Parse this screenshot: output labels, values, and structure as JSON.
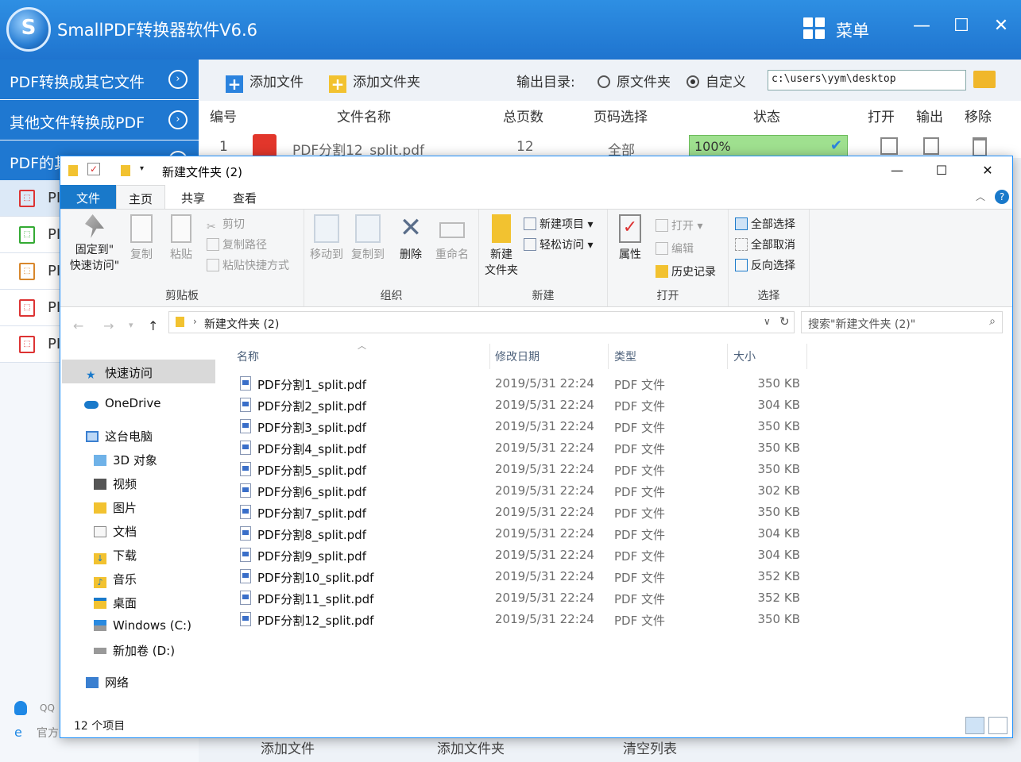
{
  "app": {
    "title": "SmallPDF转换器软件V6.6",
    "logo_letter": "S",
    "menu_label": "菜单",
    "win_min": "—",
    "win_max": "☐",
    "win_close": "✕",
    "nav": [
      {
        "label": "PDF转换成其它文件",
        "arrow": "›"
      },
      {
        "label": "其他文件转换成PDF",
        "arrow": "›"
      },
      {
        "label": "PDF的其他操作",
        "arrow": "›"
      }
    ],
    "sub_items": [
      "PI",
      "PI",
      "PI",
      "PI",
      "PI"
    ],
    "sub_first": "PI",
    "toolbar": {
      "add_file": "添加文件",
      "add_folder": "添加文件夹",
      "output_label": "输出目录:",
      "opt_source": "原文件夹",
      "opt_custom": "自定义",
      "output_path": "c:\\users\\yym\\desktop"
    },
    "table_headers": {
      "num": "编号",
      "name": "文件名称",
      "pages": "总页数",
      "page_select": "页码选择",
      "status": "状态",
      "open": "打开",
      "output": "输出",
      "remove": "移除"
    },
    "row": {
      "num": "1",
      "name": "PDF分割12_split.pdf",
      "pages": "12",
      "page_select": "全部",
      "status": "100%",
      "progress": 1.0
    },
    "bottom": {
      "add_file": "添加文件",
      "add_folder": "添加文件夹",
      "clear": "清空列表"
    },
    "foot": {
      "qq": "QQ",
      "site": "官方"
    }
  },
  "explorer": {
    "title": "新建文件夹 (2)",
    "tabs": {
      "file": "文件",
      "home": "主页",
      "share": "共享",
      "view": "查看"
    },
    "ribbon": {
      "pin_line1": "固定到\"",
      "pin_line2": "快速访问\"",
      "copy": "复制",
      "paste": "粘贴",
      "cut": "剪切",
      "copy_path": "复制路径",
      "paste_shortcut": "粘贴快捷方式",
      "group_clipboard": "剪贴板",
      "move_to": "移动到",
      "copy_to": "复制到",
      "delete": "删除",
      "rename": "重命名",
      "group_organize": "组织",
      "new_folder_line1": "新建",
      "new_folder_line2": "文件夹",
      "new_item": "新建项目",
      "easy_access": "轻松访问",
      "group_new": "新建",
      "properties": "属性",
      "open": "打开",
      "edit": "编辑",
      "history": "历史记录",
      "group_open": "打开",
      "select_all": "全部选择",
      "select_none": "全部取消",
      "invert": "反向选择",
      "group_select": "选择"
    },
    "address": "新建文件夹 (2)",
    "search_placeholder": "搜索\"新建文件夹 (2)\"",
    "nav_pane": {
      "quick_access": "快速访问",
      "onedrive": "OneDrive",
      "this_pc": "这台电脑",
      "objects3d": "3D 对象",
      "videos": "视频",
      "pictures": "图片",
      "documents": "文档",
      "downloads": "下载",
      "music": "音乐",
      "desktop": "桌面",
      "drive_c": "Windows (C:)",
      "drive_d": "新加卷 (D:)",
      "network": "网络"
    },
    "columns": {
      "name": "名称",
      "date": "修改日期",
      "type": "类型",
      "size": "大小"
    },
    "files": [
      {
        "name": "PDF分割1_split.pdf",
        "date": "2019/5/31 22:24",
        "type": "PDF 文件",
        "size": "350 KB"
      },
      {
        "name": "PDF分割2_split.pdf",
        "date": "2019/5/31 22:24",
        "type": "PDF 文件",
        "size": "304 KB"
      },
      {
        "name": "PDF分割3_split.pdf",
        "date": "2019/5/31 22:24",
        "type": "PDF 文件",
        "size": "350 KB"
      },
      {
        "name": "PDF分割4_split.pdf",
        "date": "2019/5/31 22:24",
        "type": "PDF 文件",
        "size": "350 KB"
      },
      {
        "name": "PDF分割5_split.pdf",
        "date": "2019/5/31 22:24",
        "type": "PDF 文件",
        "size": "350 KB"
      },
      {
        "name": "PDF分割6_split.pdf",
        "date": "2019/5/31 22:24",
        "type": "PDF 文件",
        "size": "302 KB"
      },
      {
        "name": "PDF分割7_split.pdf",
        "date": "2019/5/31 22:24",
        "type": "PDF 文件",
        "size": "350 KB"
      },
      {
        "name": "PDF分割8_split.pdf",
        "date": "2019/5/31 22:24",
        "type": "PDF 文件",
        "size": "304 KB"
      },
      {
        "name": "PDF分割9_split.pdf",
        "date": "2019/5/31 22:24",
        "type": "PDF 文件",
        "size": "304 KB"
      },
      {
        "name": "PDF分割10_split.pdf",
        "date": "2019/5/31 22:24",
        "type": "PDF 文件",
        "size": "352 KB"
      },
      {
        "name": "PDF分割11_split.pdf",
        "date": "2019/5/31 22:24",
        "type": "PDF 文件",
        "size": "352 KB"
      },
      {
        "name": "PDF分割12_split.pdf",
        "date": "2019/5/31 22:24",
        "type": "PDF 文件",
        "size": "350 KB"
      }
    ],
    "status": "12 个项目"
  },
  "colors": {
    "app_blue": "#1f78d1",
    "accent_blue": "#1979ca",
    "progress_green": "#9fe08f"
  }
}
